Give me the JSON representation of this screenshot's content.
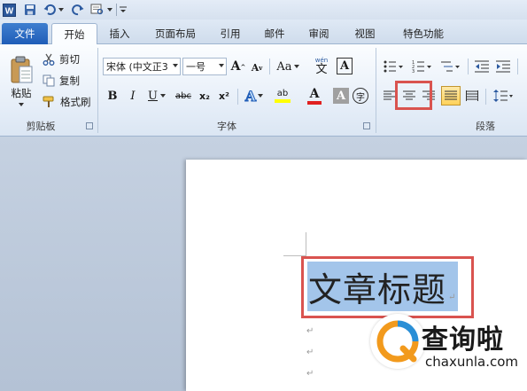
{
  "qat": {
    "app_icon": "W",
    "save_icon": "save-icon",
    "undo_icon": "undo-icon",
    "redo_icon": "redo-icon"
  },
  "tabs": [
    {
      "label": "文件"
    },
    {
      "label": "开始"
    },
    {
      "label": "插入"
    },
    {
      "label": "页面布局"
    },
    {
      "label": "引用"
    },
    {
      "label": "邮件"
    },
    {
      "label": "审阅"
    },
    {
      "label": "视图"
    },
    {
      "label": "特色功能"
    }
  ],
  "clipboard": {
    "paste_label": "粘贴",
    "cut_label": "剪切",
    "copy_label": "复制",
    "format_painter_label": "格式刷",
    "group_label": "剪贴板"
  },
  "font": {
    "font_name": "宋体 (中文正3",
    "font_size": "一号",
    "grow": "A",
    "shrink": "A",
    "change_case": "Aa",
    "phonetic": "wén",
    "bold": "B",
    "italic": "I",
    "underline": "U",
    "strike": "abc",
    "subscript": "x₂",
    "superscript": "x²",
    "text_effects": "A",
    "highlight": "ab",
    "font_color": "A",
    "char_shading": "A",
    "enclose": "字",
    "group_label": "字体"
  },
  "paragraph": {
    "group_label": "段落"
  },
  "document": {
    "title_text": "文章标题",
    "para_mark": "↵"
  },
  "watermark": {
    "name": "查询啦",
    "url": "chaxunla.com",
    "q": "Q"
  },
  "colors": {
    "accent": "#2b579a",
    "highlight_box": "#d9534f",
    "selection": "#a3c5ea",
    "watermark_orange": "#f29a1d",
    "watermark_blue": "#2a8fd6"
  }
}
